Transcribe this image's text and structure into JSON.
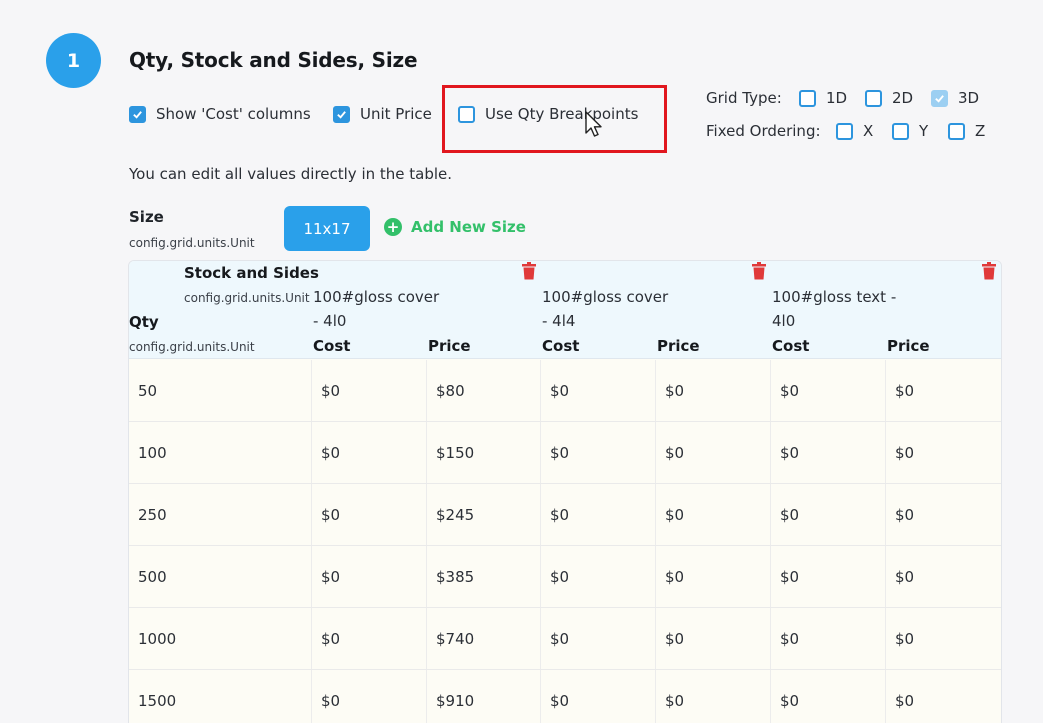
{
  "step": {
    "number": "1",
    "title": "Qty, Stock and Sides, Size"
  },
  "options": {
    "show_cost": {
      "label": "Show 'Cost' columns",
      "checked": true
    },
    "unit_price": {
      "label": "Unit Price",
      "checked": true
    },
    "qty_breakpoints": {
      "label": "Use Qty Breakpoints",
      "checked": false
    }
  },
  "grid_type": {
    "label": "Grid Type:",
    "options": [
      {
        "label": "1D",
        "checked": false
      },
      {
        "label": "2D",
        "checked": false
      },
      {
        "label": "3D",
        "checked": true
      }
    ]
  },
  "fixed_ordering": {
    "label": "Fixed Ordering:",
    "options": [
      {
        "label": "X",
        "checked": false
      },
      {
        "label": "Y",
        "checked": false
      },
      {
        "label": "Z",
        "checked": false
      }
    ]
  },
  "help_text": "You can edit all values directly in the table.",
  "size": {
    "label": "Size",
    "unit": "config.grid.units.Unit",
    "chips": [
      "11x17"
    ],
    "add_label": "Add New Size"
  },
  "table": {
    "stock_label": "Stock and Sides",
    "stock_unit": "config.grid.units.Unit",
    "qty_label": "Qty",
    "qty_unit": "config.grid.units.Unit",
    "stocks": [
      {
        "name": "100#gloss cover - 4l0",
        "cost_label": "Cost",
        "price_label": "Price"
      },
      {
        "name": "100#gloss cover - 4l4",
        "cost_label": "Cost",
        "price_label": "Price"
      },
      {
        "name": "100#gloss text - 4l0",
        "cost_label": "Cost",
        "price_label": "Price"
      }
    ],
    "rows": [
      {
        "qty": "50",
        "cells": [
          "$0",
          "$80",
          "$0",
          "$0",
          "$0",
          "$0"
        ]
      },
      {
        "qty": "100",
        "cells": [
          "$0",
          "$150",
          "$0",
          "$0",
          "$0",
          "$0"
        ]
      },
      {
        "qty": "250",
        "cells": [
          "$0",
          "$245",
          "$0",
          "$0",
          "$0",
          "$0"
        ]
      },
      {
        "qty": "500",
        "cells": [
          "$0",
          "$385",
          "$0",
          "$0",
          "$0",
          "$0"
        ]
      },
      {
        "qty": "1000",
        "cells": [
          "$0",
          "$740",
          "$0",
          "$0",
          "$0",
          "$0"
        ]
      },
      {
        "qty": "1500",
        "cells": [
          "$0",
          "$910",
          "$0",
          "$0",
          "$0",
          "$0"
        ]
      }
    ]
  },
  "colors": {
    "accent": "#2aa0ea",
    "add": "#33c06a",
    "highlight": "#e1171f",
    "trash": "#e03a3a"
  }
}
